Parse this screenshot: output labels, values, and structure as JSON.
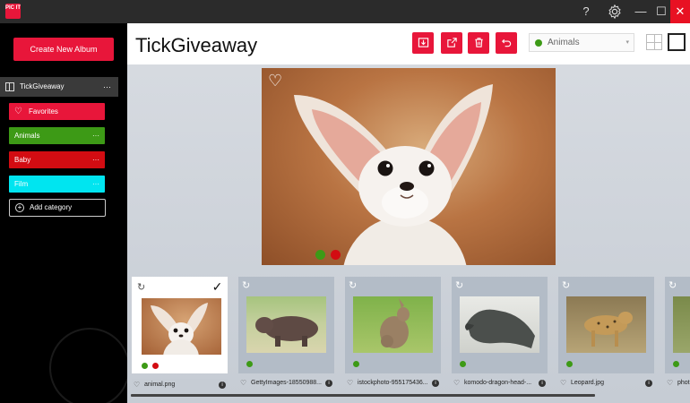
{
  "app": {
    "logo_text": "PIC IT"
  },
  "titlebar": {
    "help": "?",
    "settings": "⚙",
    "minimize": "—",
    "maximize": "☐",
    "close": "✕"
  },
  "sidebar": {
    "create_label": "Create New Album",
    "album": {
      "name": "TickGiveaway",
      "menu": "···"
    },
    "categories": [
      {
        "label": "Favorites",
        "color": "#e8163a"
      },
      {
        "label": "Animals",
        "color": "#3d9a16",
        "menu": "···"
      },
      {
        "label": "Baby",
        "color": "#d30c12",
        "menu": "···"
      },
      {
        "label": "Film",
        "color": "#00e5f0",
        "menu": "···"
      }
    ],
    "add_category": "Add category"
  },
  "header": {
    "title": "TickGiveaway",
    "category_select": {
      "selected": "Animals",
      "color": "#3d9a16"
    },
    "actions": [
      "download-icon",
      "share-icon",
      "trash-icon",
      "undo-icon"
    ],
    "view_modes": [
      "grid-view-icon",
      "single-view-icon"
    ]
  },
  "preview": {
    "favorite": "♡",
    "tags": [
      "#3d9a16",
      "#d30c12"
    ]
  },
  "thumbnails": [
    {
      "name": "animal.png",
      "selected": true,
      "tags": [
        "#3d9a16",
        "#d30c12"
      ]
    },
    {
      "name": "GettyImages-18550988...",
      "selected": false,
      "tags": [
        "#3d9a16"
      ]
    },
    {
      "name": "istockphoto-955175436...",
      "selected": false,
      "tags": [
        "#3d9a16"
      ]
    },
    {
      "name": "komodo-dragon-head-...",
      "selected": false,
      "tags": [
        "#3d9a16"
      ]
    },
    {
      "name": "Leopard.jpg",
      "selected": false,
      "tags": [
        "#3d9a16"
      ]
    },
    {
      "name": "phot",
      "selected": false,
      "tags": [
        "#3d9a16"
      ]
    }
  ],
  "thumb_icons": {
    "refresh": "↻",
    "check": "✓",
    "heart": "♡",
    "info": "i"
  }
}
